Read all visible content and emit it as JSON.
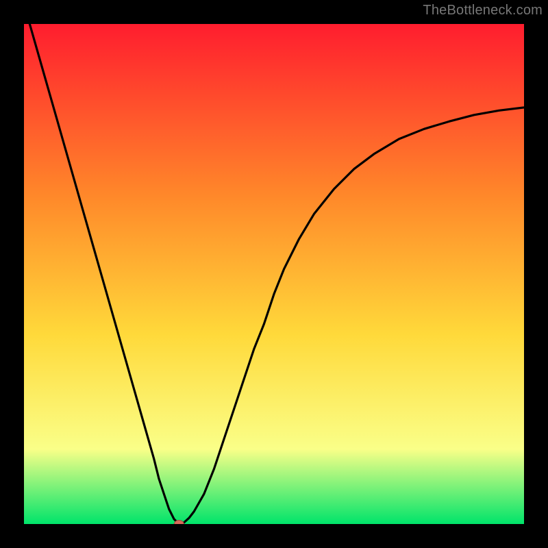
{
  "watermark": {
    "text": "TheBottleneck.com"
  },
  "colors": {
    "frame_bg": "#000000",
    "gradient_top": "#ff1d2e",
    "gradient_mid_upper": "#ff8a2a",
    "gradient_mid": "#ffd93a",
    "gradient_mid_lower": "#faff88",
    "gradient_bottom": "#00e46a",
    "curve": "#000000",
    "marker_fill": "#d96a5a",
    "marker_stroke": "#a84a3e"
  },
  "chart_data": {
    "type": "line",
    "title": "",
    "xlabel": "",
    "ylabel": "",
    "xlim": [
      0,
      100
    ],
    "ylim": [
      0,
      100
    ],
    "grid": false,
    "legend": false,
    "x": [
      0,
      2,
      4,
      6,
      8,
      10,
      12,
      14,
      16,
      18,
      20,
      22,
      24,
      26,
      27,
      28,
      29,
      30,
      31,
      32,
      33,
      34,
      36,
      38,
      40,
      42,
      44,
      46,
      48,
      50,
      52,
      55,
      58,
      62,
      66,
      70,
      75,
      80,
      85,
      90,
      95,
      100
    ],
    "values": [
      104,
      97,
      90,
      83,
      76,
      69,
      62,
      55,
      48,
      41,
      34,
      27,
      20,
      13,
      9,
      6,
      3,
      1,
      0,
      0.3,
      1.2,
      2.5,
      6,
      11,
      17,
      23,
      29,
      35,
      40,
      46,
      51,
      57,
      62,
      67,
      71,
      74,
      77,
      79,
      80.5,
      81.8,
      82.7,
      83.3
    ],
    "marker": {
      "x": 31,
      "y": 0
    },
    "notes": "Axes are unlabeled; x treated as 0–100 (% of horizontal span), y as 0–100 (% bottleneck). Curve is a V-shape hitting ~0 near x≈31 then rising and flattening toward the right."
  }
}
